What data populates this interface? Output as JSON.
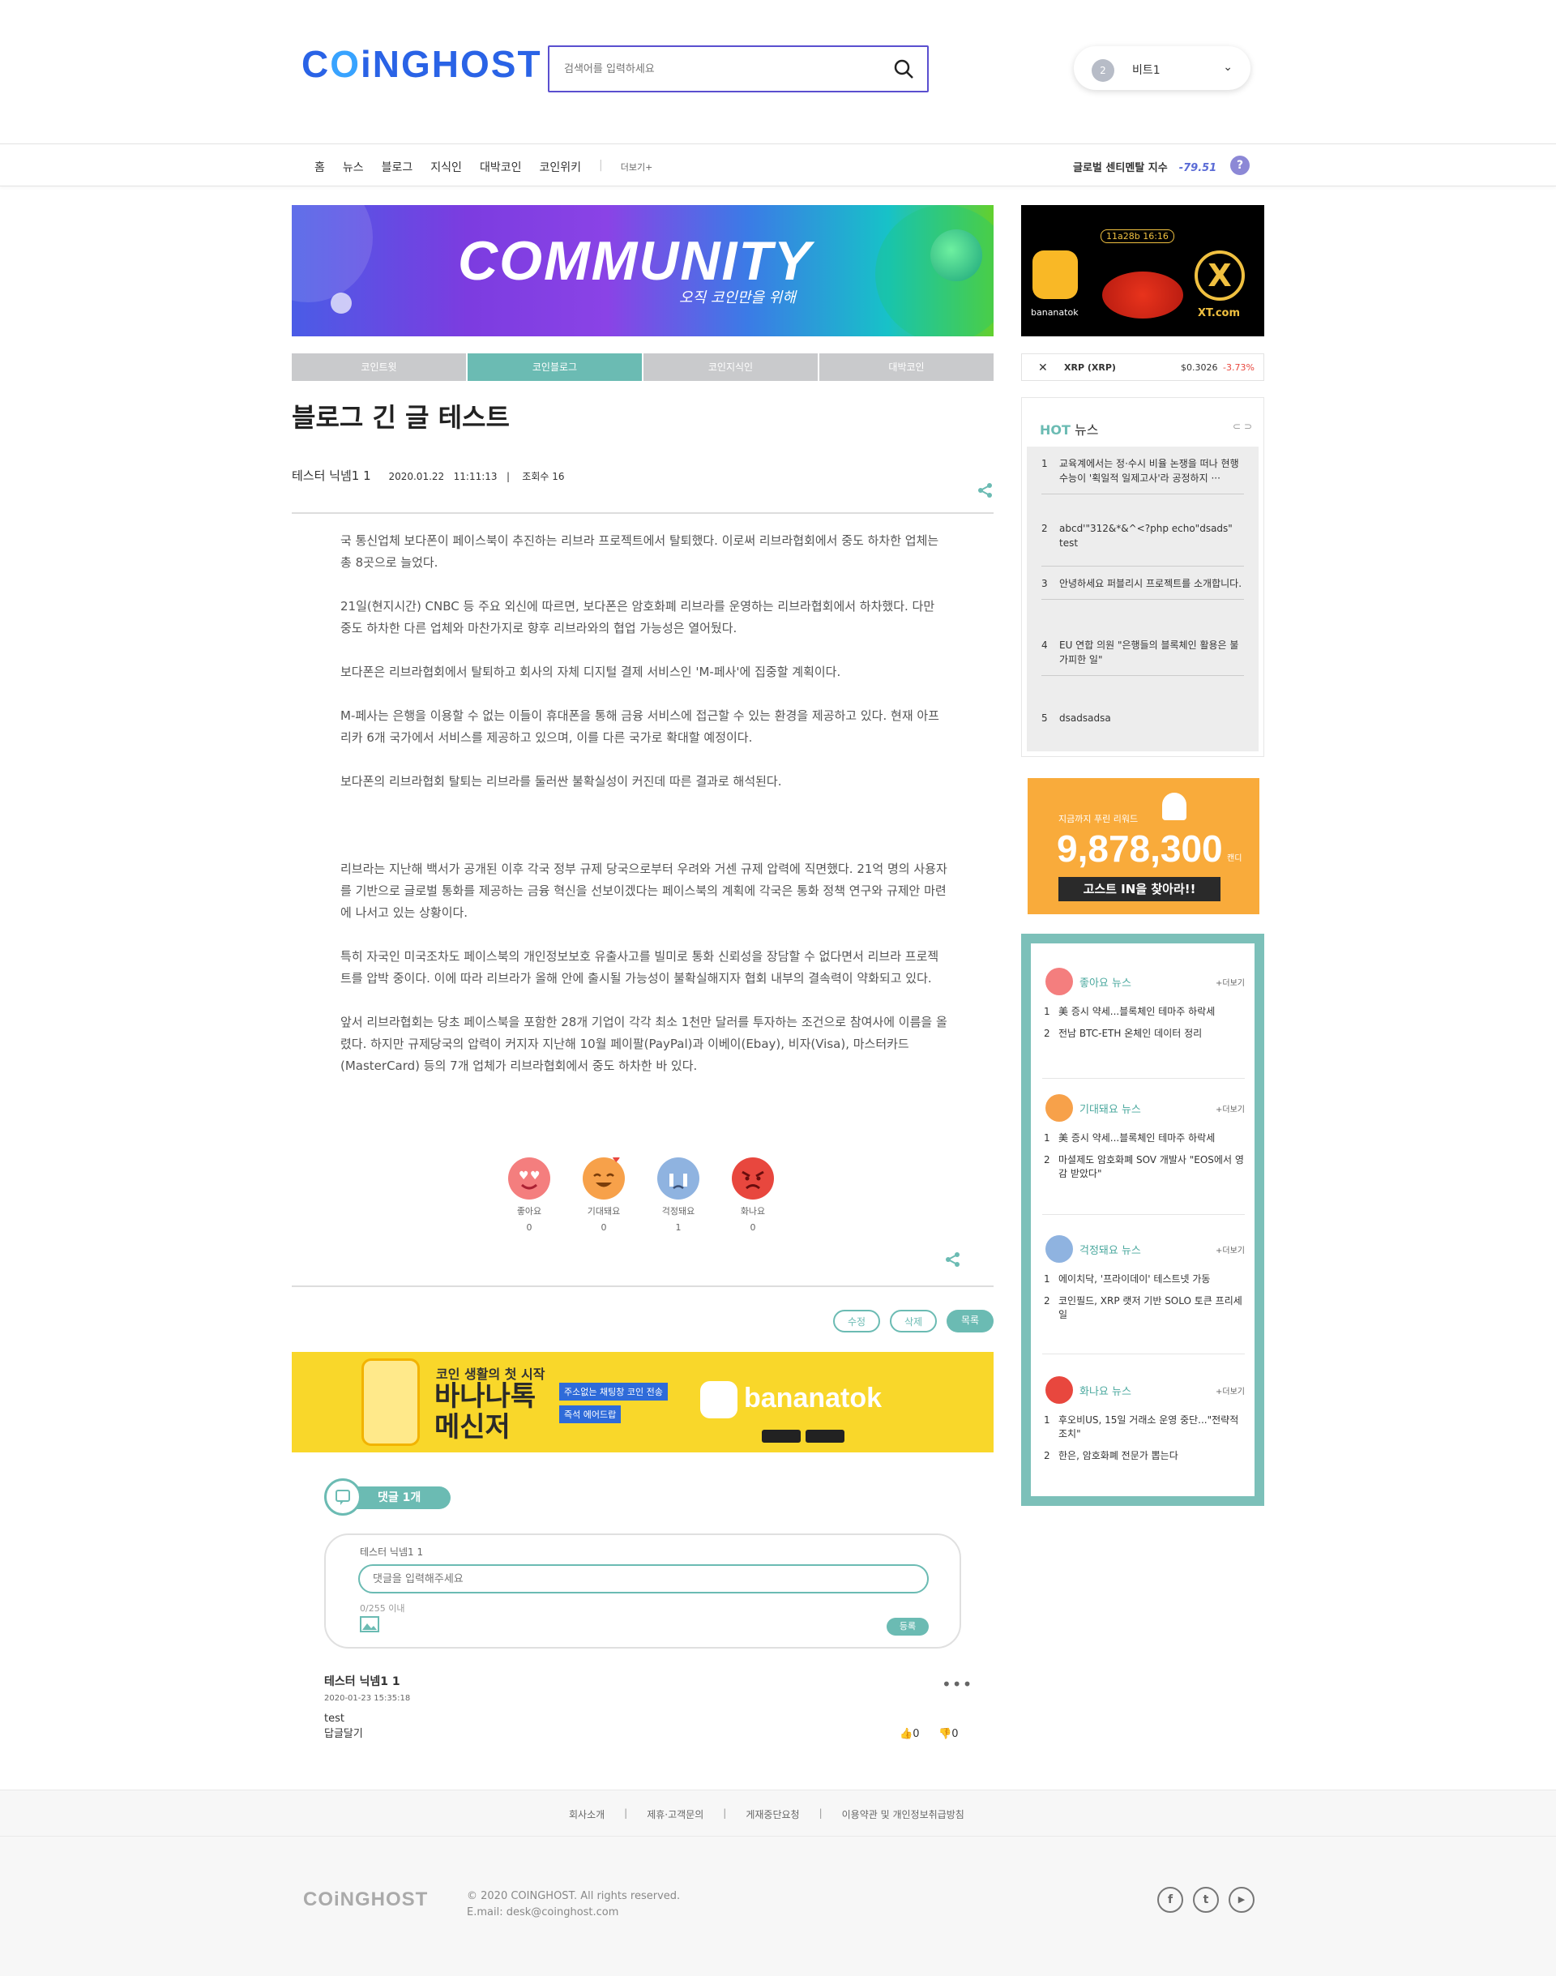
{
  "header": {
    "logo": "COiNGHOST",
    "search_placeholder": "검색어를 입력하세요",
    "user_level": "2",
    "user_name": "비트1"
  },
  "gnb": {
    "items": [
      "홈",
      "뉴스",
      "블로그",
      "지식인",
      "대박코인",
      "코인위키"
    ],
    "more": "더보기+",
    "sentiment_label": "글로벌 센티멘탈 지수",
    "sentiment_value": "-79.51",
    "help": "?"
  },
  "banner": {
    "title": "COMMUNITY",
    "subtitle": "오직 코인만을 위해"
  },
  "tabs": [
    "코인트윗",
    "코인블로그",
    "코인지식인",
    "대박코인"
  ],
  "post": {
    "title": "블로그 긴 글 테스트",
    "author": "테스터 닉넴1 1",
    "date": "2020.01.22",
    "time": "11:11:13",
    "views": "조회수 16",
    "paragraphs": [
      "국 통신업체 보다폰이 페이스북이 추진하는 리브라 프로젝트에서 탈퇴했다. 이로써 리브라협회에서 중도 하차한 업체는 총 8곳으로 늘었다.",
      "21일(현지시간) CNBC 등 주요 외신에 따르면, 보다폰은 암호화폐 리브라를 운영하는 리브라협회에서 하차했다. 다만 중도 하차한 다른 업체와 마찬가지로 향후 리브라와의 협업 가능성은 열어뒀다.",
      "보다폰은 리브라협회에서 탈퇴하고 회사의 자체 디지털 결제 서비스인 'M-페사'에 집중할 계획이다.",
      "M-페사는 은행을 이용할 수 없는 이들이 휴대폰을 통해 금융 서비스에 접근할 수 있는 환경을 제공하고 있다. 현재 아프리카 6개 국가에서 서비스를 제공하고 있으며, 이를 다른 국가로 확대할 예정이다.",
      "보다폰의 리브라협회 탈퇴는 리브라를 둘러싼 불확실성이 커진데 따른 결과로 해석된다.",
      "리브라는 지난해 백서가 공개된 이후 각국 정부 규제 당국으로부터 우려와 거센 규제 압력에 직면했다. 21억 명의 사용자를 기반으로 글로벌 통화를 제공하는 금융 혁신을 선보이겠다는 페이스북의 계획에 각국은 통화 정책 연구와 규제안 마련에 나서고 있는 상황이다.",
      "특히 자국인 미국조차도 페이스북의 개인정보보호 유출사고를 빌미로 통화 신뢰성을 장담할 수 없다면서 리브라 프로젝트를 압박 중이다. 이에 따라 리브라가 올해 안에 출시될 가능성이 불확실해지자 협회 내부의 결속력이 약화되고 있다.",
      "앞서 리브라협회는 당초 페이스북을 포함한 28개 기업이 각각 최소 1천만 달러를 투자하는 조건으로 참여사에 이름을 올렸다. 하지만 규제당국의 압력이 커지자 지난해 10월 페이팔(PayPal)과 이베이(Ebay), 비자(Visa), 마스터카드(MasterCard) 등의 7개 업체가 리브라협회에서 중도 하차한 바 있다."
    ]
  },
  "reactions": [
    {
      "label": "좋아요",
      "count": "0",
      "color": "#f47e7e"
    },
    {
      "label": "기대돼요",
      "count": "0",
      "color": "#f7a14a"
    },
    {
      "label": "걱정돼요",
      "count": "1",
      "color": "#8fb3e0"
    },
    {
      "label": "화나요",
      "count": "0",
      "color": "#e8473e"
    }
  ],
  "post_actions": {
    "edit": "수정",
    "delete": "삭제",
    "list": "목록"
  },
  "ad2": {
    "line1": "코인 생활의 첫 시작",
    "line2": "바나나톡",
    "line3": "메신저",
    "tag1": "주소없는 채팅창 코인 전송",
    "tag2": "즉석 에어드랍",
    "brand": "bananatok"
  },
  "comments": {
    "header": "댓글 1개",
    "writer": "테스터 닉넴1 1",
    "placeholder": "댓글을 입력해주세요",
    "char_count": "0/255 이내",
    "submit": "등록",
    "items": [
      {
        "author": "테스터 닉넴1 1",
        "date": "2020-01-23 15:35:18",
        "text": "test",
        "reply": "답글달기",
        "likes": "0",
        "dislikes": "0"
      }
    ]
  },
  "sidebar": {
    "ad_time": "11a28b 16:16",
    "ad_left": "bananatok",
    "ad_right": "XT.com",
    "ticker": {
      "name": "XRP (XRP)",
      "price": "$0.3026",
      "change": "-3.73%"
    },
    "hot": {
      "title_en": "HOT",
      "title_ko": "뉴스",
      "items": [
        "교육계에서는 정·수시 비율 논쟁을 떠나 현행 수능이 '획일적 일제고사'라 공정하지 ···",
        "abcd'\"312&*&^<?php echo\"dsads\" test",
        "안녕하세요 퍼블리시 프로젝트를 소개합니다.",
        "EU 연합 의원 \"은행들의 블록체인 활용은 불가피한 일\"",
        "dsadsadsa"
      ]
    },
    "reward": {
      "label": "지금까지 푸린 리워드",
      "amount": "9,878,300",
      "unit": "캔디",
      "button": "고스트 IN을 찾아라!!"
    },
    "emotion_news": [
      {
        "title": "좋아요 뉴스",
        "more": "+더보기",
        "items": [
          "美 증시 약세...블록체인 테마주 하락세",
          "전남 BTC-ETH 온체인 데이터 정리"
        ]
      },
      {
        "title": "기대돼요 뉴스",
        "more": "+더보기",
        "items": [
          "美 증시 약세...블록체인 테마주 하락세",
          "마셜제도 암호화폐 SOV 개발사 \"EOS에서 영감 받았다\""
        ]
      },
      {
        "title": "걱정돼요 뉴스",
        "more": "+더보기",
        "items": [
          "에이치닥, '프라이데이' 테스트넷 가동",
          "코인필드, XRP 랫저 기반 SOLO 토큰 프리세일"
        ]
      },
      {
        "title": "화나요 뉴스",
        "more": "+더보기",
        "items": [
          "후오비US, 15일 거래소 운영 중단...\"전략적 조치\"",
          "한은, 암호화폐 전문가 뽑는다"
        ]
      }
    ]
  },
  "footer": {
    "links": [
      "회사소개",
      "제휴·고객문의",
      "게재중단요청",
      "이용약관 및 개인정보취급방침"
    ],
    "logo": "COiNGHOST",
    "copyright": "© 2020 COINGHOST. All rights reserved.",
    "email": "E.mail: desk@coinghost.com",
    "sns": [
      "f",
      "t",
      "▶"
    ]
  }
}
